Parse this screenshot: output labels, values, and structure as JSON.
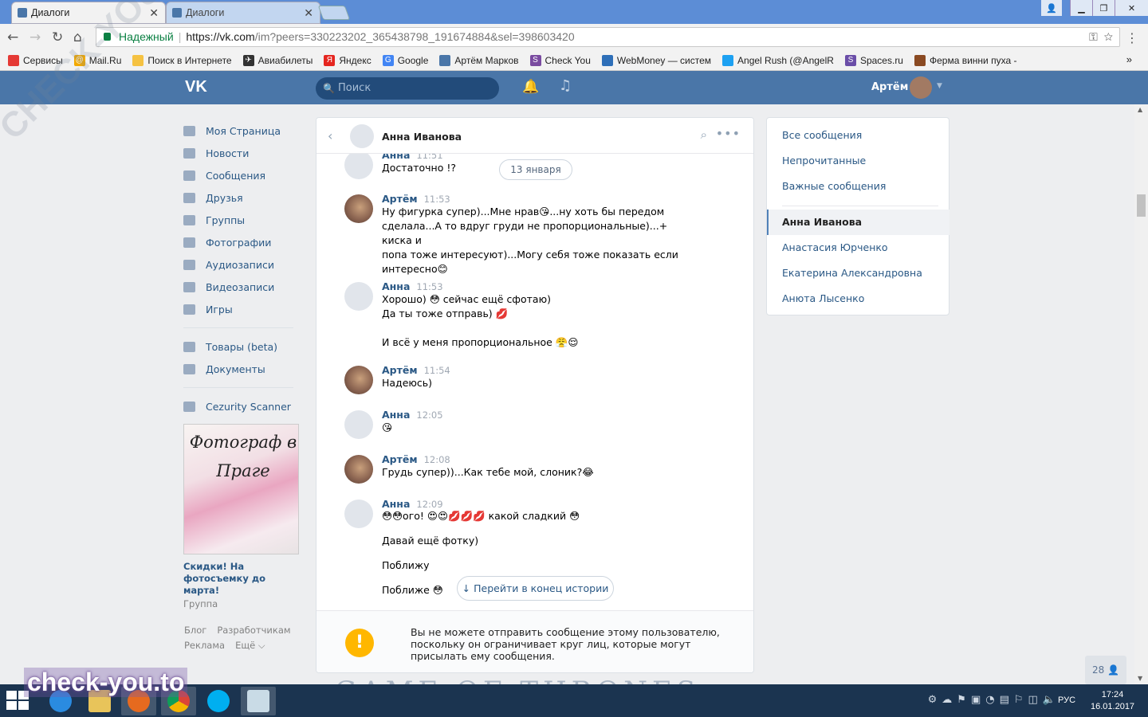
{
  "browser": {
    "tabs": [
      {
        "title": "Диалоги"
      },
      {
        "title": "Диалоги"
      }
    ],
    "secure_label": "Надежный",
    "url_host": "https://vk.com",
    "url_path": "/im?peers=330223202_365438798_191674884&sel=398603420",
    "bookmarks": [
      "Сервисы",
      "Mail.Ru",
      "Поиск в Интернете",
      "Авиабилеты",
      "Яндекс",
      "Google",
      "Артём Марков",
      "Check You",
      "WebMoney — систем",
      "Angel Rush (@AngelR",
      "Spaces.ru",
      "Ферма винни пуха - "
    ]
  },
  "vk": {
    "logo": "VK",
    "search_placeholder": "Поиск",
    "user_name": "Артём"
  },
  "left_menu": {
    "items": [
      "Моя Страница",
      "Новости",
      "Сообщения",
      "Друзья",
      "Группы",
      "Фотографии",
      "Аудиозаписи",
      "Видеозаписи",
      "Игры"
    ],
    "items2": [
      "Товары (beta)",
      "Документы"
    ],
    "items3": [
      "Cezurity Scanner"
    ],
    "ad": {
      "image_text": "Фотограф в Праге",
      "title": "Скидки! На фотосъемку до марта!",
      "subtitle": "Группа"
    },
    "footer": [
      "Блог",
      "Разработчикам",
      "Реклама",
      "Ещё ⌵"
    ]
  },
  "chat": {
    "title": "Анна Иванова",
    "date_chip": "13 января",
    "messages": [
      {
        "author": "Анна",
        "time": "11:51",
        "text": "Достаточно !?"
      },
      {
        "author": "Артём",
        "time": "11:53",
        "text": "Ну фигурка супер)...Мне нрав😘...ну хоть бы передом\nсделала...А то вдруг груди не пропорциональные)...+ киска и\nпопа тоже интересуют)...Могу себя тоже показать если\nинтересно😊"
      },
      {
        "author": "Анна",
        "time": "11:53",
        "text": "Хорошо) 😳 сейчас ещё сфотаю)\nДа ты тоже отправь) 💋\n\nИ всё у меня пропорциональное 😤😌"
      },
      {
        "author": "Артём",
        "time": "11:54",
        "text": "Надеюсь)"
      },
      {
        "author": "Анна",
        "time": "12:05",
        "text": "😘"
      },
      {
        "author": "Артём",
        "time": "12:08",
        "text": "Грудь супер))...Как тебе мой, слоник?😂"
      },
      {
        "author": "Анна",
        "time": "12:09",
        "text": "😳😳ого! 😍😍💋💋💋 какой сладкий 😳\n\nДавай ещё фотку)\n\nПоближу\n\nПоближе 😳"
      }
    ],
    "jump_button": "↓  Перейти в конец истории",
    "notice_icon": "!",
    "notice": "Вы не можете отправить сообщение этому пользователю, поскольку он ограничивает круг лиц, которые могут присылать ему сообщения."
  },
  "right_panel": {
    "filters": [
      "Все сообщения",
      "Непрочитанные",
      "Важные сообщения"
    ],
    "active": "Анна Иванова",
    "dialogs": [
      "Анастасия Юрченко",
      "Екатерина Александровна",
      "Анюта Лысенко"
    ]
  },
  "notif_count": "28 👤",
  "banner_text": "GAME OF THRONES",
  "watermarks": {
    "corner": "CHECK-YOU.ME",
    "logo": "check-you.to"
  },
  "taskbar": {
    "lang": "РУС",
    "time": "17:24",
    "date": "16.01.2017"
  },
  "colors": {
    "vk_blue": "#4a76a8",
    "link": "#2a5885",
    "warning": "#ffb700"
  }
}
